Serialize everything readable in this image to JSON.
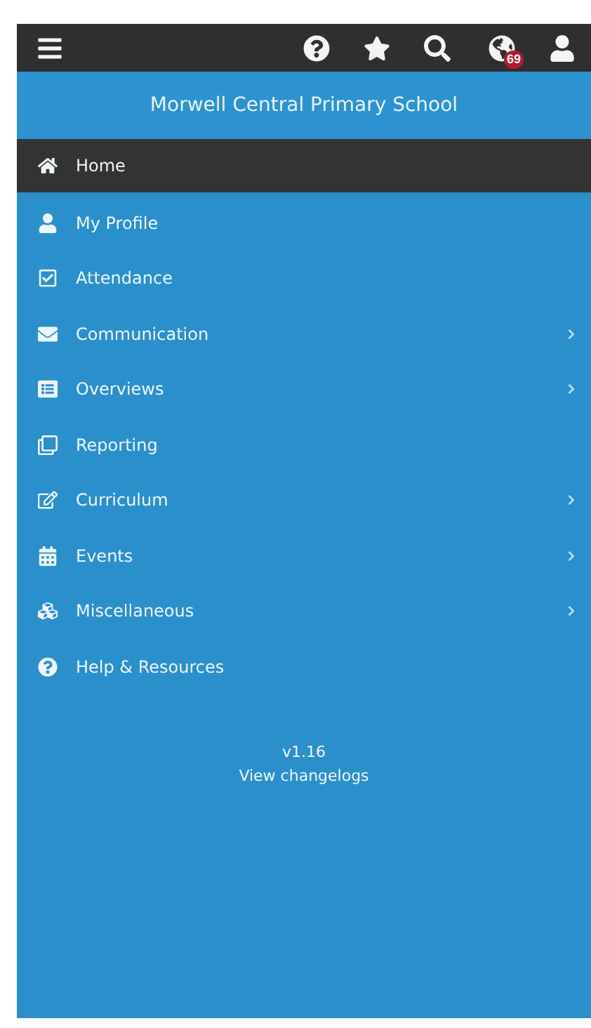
{
  "header": {
    "notification_badge": "69"
  },
  "school_name": "Morwell Central Primary School",
  "menu": [
    {
      "label": "Home",
      "selected": true,
      "has_submenu": false
    },
    {
      "label": "My Profile",
      "selected": false,
      "has_submenu": false
    },
    {
      "label": "Attendance",
      "selected": false,
      "has_submenu": false
    },
    {
      "label": "Communication",
      "selected": false,
      "has_submenu": true
    },
    {
      "label": "Overviews",
      "selected": false,
      "has_submenu": true
    },
    {
      "label": "Reporting",
      "selected": false,
      "has_submenu": false
    },
    {
      "label": "Curriculum",
      "selected": false,
      "has_submenu": true
    },
    {
      "label": "Events",
      "selected": false,
      "has_submenu": true
    },
    {
      "label": "Miscellaneous",
      "selected": false,
      "has_submenu": true
    },
    {
      "label": "Help & Resources",
      "selected": false,
      "has_submenu": false
    }
  ],
  "footer": {
    "version": "v1.16",
    "changelog_link": "View changelogs"
  }
}
